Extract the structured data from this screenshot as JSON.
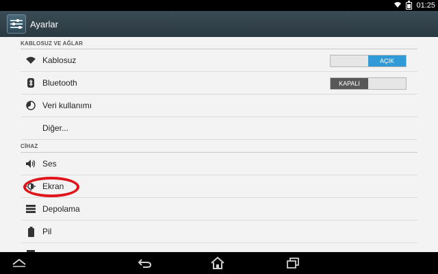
{
  "status_bar": {
    "time": "01:25",
    "icons": [
      "wifi-icon",
      "battery-icon"
    ]
  },
  "action_bar": {
    "title": "Ayarlar"
  },
  "sections": [
    {
      "header": "KABLOSUZ VE AĞLAR",
      "items": [
        {
          "label": "Kablosuz",
          "icon": "wifi-icon",
          "toggle": {
            "state": "on",
            "label": "AÇIK"
          }
        },
        {
          "label": "Bluetooth",
          "icon": "bluetooth-icon",
          "toggle": {
            "state": "off",
            "label": "KAPALI"
          }
        },
        {
          "label": "Veri kullanımı",
          "icon": "data-usage-icon"
        },
        {
          "label": "Diğer..."
        }
      ]
    },
    {
      "header": "CİHAZ",
      "items": [
        {
          "label": "Ses",
          "icon": "volume-icon"
        },
        {
          "label": "Ekran",
          "icon": "brightness-icon"
        },
        {
          "label": "Depolama",
          "icon": "storage-icon"
        },
        {
          "label": "Pil",
          "icon": "battery-icon"
        }
      ]
    }
  ],
  "annotation": {
    "color": "#e0141b",
    "target": "Ekran"
  },
  "nav_bar": {
    "buttons": [
      "collapse-icon",
      "back-icon",
      "home-icon",
      "recent-apps-icon"
    ]
  },
  "colors": {
    "toggle_on": "#2f9ad6",
    "toggle_off": "#585858",
    "action_bar": "#2b3840"
  }
}
